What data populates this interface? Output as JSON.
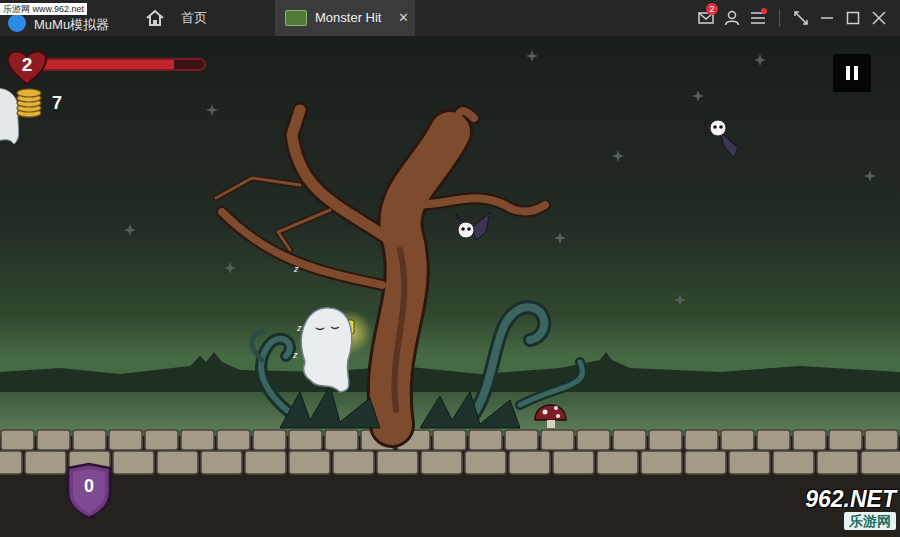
{
  "window": {
    "logo": "MuMu模拟器",
    "watermark": "乐游网 www.962.net"
  },
  "tabs": [
    {
      "label": "首页",
      "selected": false
    },
    {
      "label": "Monster Hit",
      "selected": true,
      "close": "✕"
    }
  ],
  "toolbar": {
    "mail_badge": "2",
    "menu_dot": true
  },
  "hud": {
    "lives": "2",
    "health_level": 0.82,
    "coins": "7",
    "shield": "0"
  },
  "scene": {
    "sleep_marks": [
      "z",
      "z",
      "z"
    ]
  },
  "corner_watermark": {
    "brand": "962.NET",
    "name": "乐游网"
  }
}
